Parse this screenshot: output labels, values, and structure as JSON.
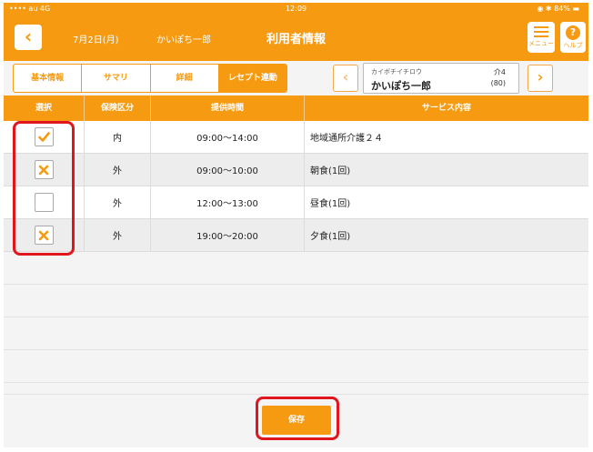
{
  "status": {
    "carrier": "•••• au  4G",
    "time": "12:09",
    "battery": "◉ ✱ 84% ▬"
  },
  "header": {
    "date": "7月2日(月)",
    "user": "かいぽち一郎",
    "title": "利用者情報",
    "menu_label": "メニュー",
    "help_label": "ヘルプ",
    "help_glyph": "?"
  },
  "tabs": [
    {
      "label": "基本情報",
      "active": false
    },
    {
      "label": "サマリ",
      "active": false
    },
    {
      "label": "詳細",
      "active": false
    },
    {
      "label": "レセプト連動",
      "active": true
    }
  ],
  "patient": {
    "kana": "カイボチイチロウ",
    "care_level": "介4",
    "name": "かいぽち一郎",
    "age": "(80)"
  },
  "table": {
    "headers": [
      "選択",
      "保険区分",
      "提供時間",
      "サービス内容"
    ],
    "rows": [
      {
        "state": "check",
        "insurance": "内",
        "time": "09:00〜14:00",
        "service": "地域通所介護２４"
      },
      {
        "state": "cross",
        "insurance": "外",
        "time": "09:00〜10:00",
        "service": "朝食(1回)"
      },
      {
        "state": "empty",
        "insurance": "外",
        "time": "12:00〜13:00",
        "service": "昼食(1回)"
      },
      {
        "state": "cross",
        "insurance": "外",
        "time": "19:00〜20:00",
        "service": "夕食(1回)"
      }
    ]
  },
  "save_label": "保存",
  "colors": {
    "accent": "#f59a11",
    "highlight": "#e0151d"
  }
}
